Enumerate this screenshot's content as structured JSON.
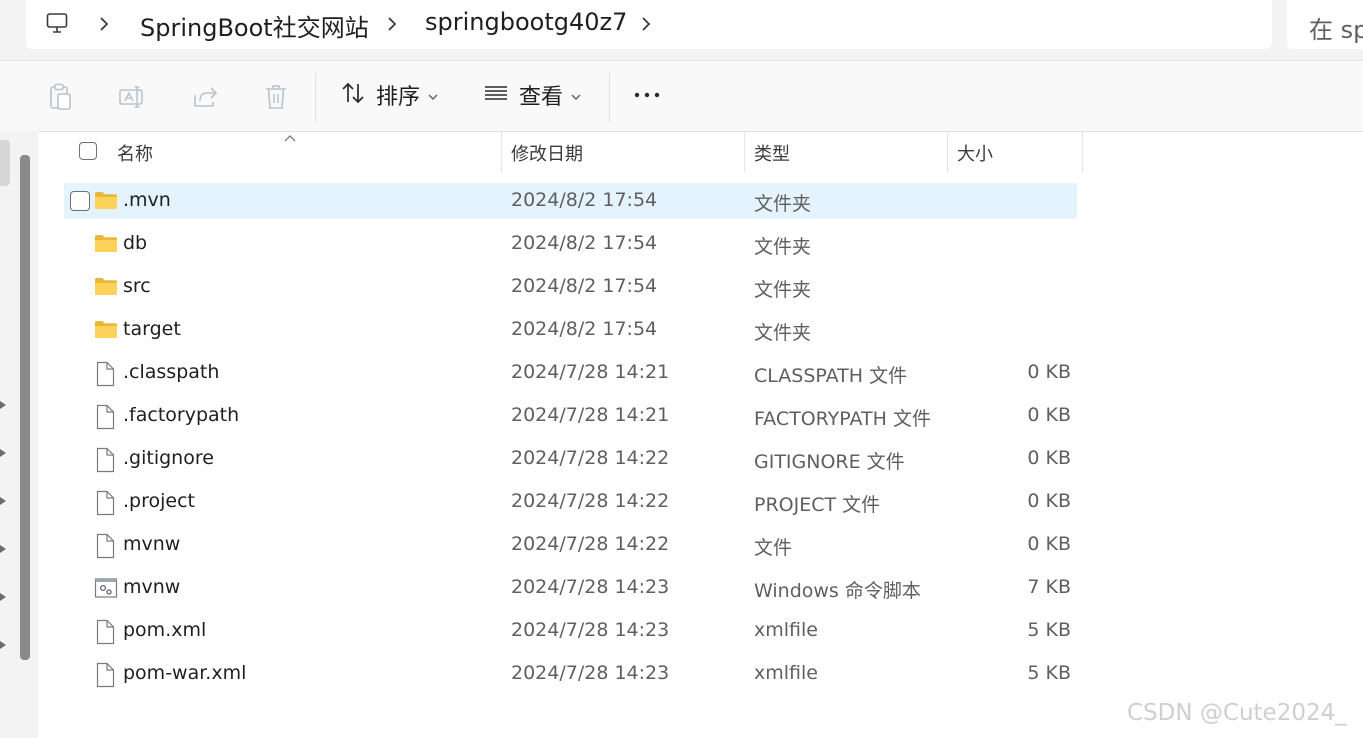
{
  "address_bar": {
    "icons": {
      "this_pc": "computer-icon",
      "chevron": "chevron-right-icon"
    },
    "crumbs": [
      "SpringBoot社交网站",
      "springbootg40z7"
    ],
    "search_text": "在 sp"
  },
  "toolbar": {
    "icons": [
      "paste-icon",
      "rename-icon",
      "share-icon",
      "delete-icon"
    ],
    "sort_label": "排序",
    "view_label": "查看",
    "more_label": "…"
  },
  "columns": {
    "name": "名称",
    "date": "修改日期",
    "type": "类型",
    "size": "大小"
  },
  "files": [
    {
      "name": ".mvn",
      "date": "2024/8/2 17:54",
      "type": "文件夹",
      "size": "",
      "icon": "folder-icon",
      "selected": true
    },
    {
      "name": "db",
      "date": "2024/8/2 17:54",
      "type": "文件夹",
      "size": "",
      "icon": "folder-icon"
    },
    {
      "name": "src",
      "date": "2024/8/2 17:54",
      "type": "文件夹",
      "size": "",
      "icon": "folder-icon"
    },
    {
      "name": "target",
      "date": "2024/8/2 17:54",
      "type": "文件夹",
      "size": "",
      "icon": "folder-icon"
    },
    {
      "name": ".classpath",
      "date": "2024/7/28 14:21",
      "type": "CLASSPATH 文件",
      "size": "0 KB",
      "icon": "file-icon"
    },
    {
      "name": ".factorypath",
      "date": "2024/7/28 14:21",
      "type": "FACTORYPATH 文件",
      "size": "0 KB",
      "icon": "file-icon"
    },
    {
      "name": ".gitignore",
      "date": "2024/7/28 14:22",
      "type": "GITIGNORE 文件",
      "size": "0 KB",
      "icon": "file-icon"
    },
    {
      "name": ".project",
      "date": "2024/7/28 14:22",
      "type": "PROJECT 文件",
      "size": "0 KB",
      "icon": "file-icon"
    },
    {
      "name": "mvnw",
      "date": "2024/7/28 14:22",
      "type": "文件",
      "size": "0 KB",
      "icon": "file-icon"
    },
    {
      "name": "mvnw",
      "date": "2024/7/28 14:23",
      "type": "Windows 命令脚本",
      "size": "7 KB",
      "icon": "script-icon"
    },
    {
      "name": "pom.xml",
      "date": "2024/7/28 14:23",
      "type": "xmlfile",
      "size": "5 KB",
      "icon": "file-icon"
    },
    {
      "name": "pom-war.xml",
      "date": "2024/7/28 14:23",
      "type": "xmlfile",
      "size": "5 KB",
      "icon": "file-icon"
    }
  ],
  "watermark": "CSDN @Cute2024_"
}
